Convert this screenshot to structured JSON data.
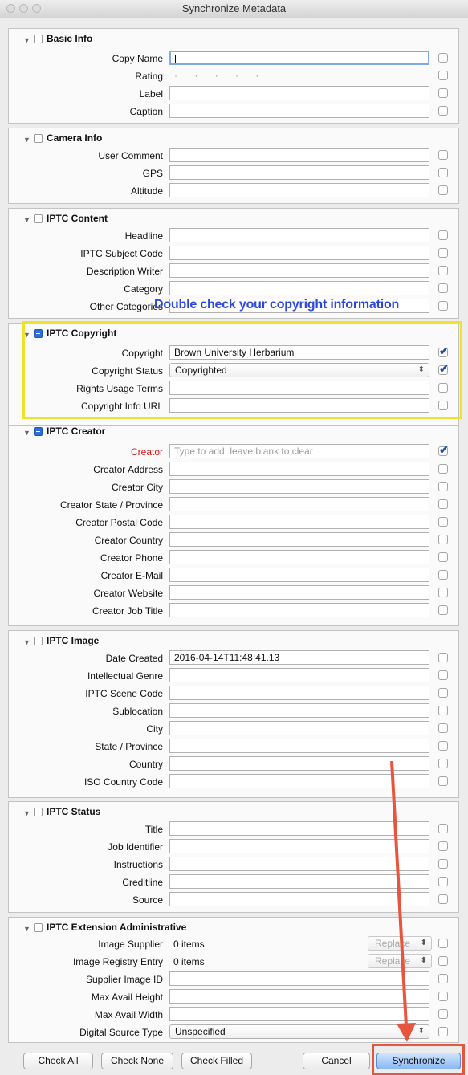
{
  "window": {
    "title": "Synchronize Metadata"
  },
  "sections": {
    "basic": {
      "title": "Basic Info",
      "copy_name": "Copy Name",
      "rating": "Rating",
      "rating_value": "· · · · ·",
      "label": "Label",
      "caption": "Caption"
    },
    "camera": {
      "title": "Camera Info",
      "user_comment": "User Comment",
      "gps": "GPS",
      "altitude": "Altitude"
    },
    "content": {
      "title": "IPTC Content",
      "headline": "Headline",
      "subject_code": "IPTC Subject Code",
      "description_writer": "Description Writer",
      "category": "Category",
      "other_categories": "Other Categories"
    },
    "copyright": {
      "title": "IPTC Copyright",
      "copyright": "Copyright",
      "copyright_value": "Brown University Herbarium",
      "status": "Copyright Status",
      "status_value": "Copyrighted",
      "usage_terms": "Rights Usage Terms",
      "info_url": "Copyright Info URL"
    },
    "creator": {
      "title": "IPTC Creator",
      "creator": "Creator",
      "creator_placeholder": "Type to add, leave blank to clear",
      "address": "Creator Address",
      "city": "Creator City",
      "state": "Creator State / Province",
      "postal": "Creator Postal Code",
      "country": "Creator Country",
      "phone": "Creator Phone",
      "email": "Creator E-Mail",
      "website": "Creator Website",
      "job_title": "Creator Job Title"
    },
    "image": {
      "title": "IPTC Image",
      "date_created": "Date Created",
      "date_value": "2016-04-14T11:48:41.13",
      "genre": "Intellectual Genre",
      "scene_code": "IPTC Scene Code",
      "sublocation": "Sublocation",
      "city": "City",
      "state": "State / Province",
      "country": "Country",
      "iso_code": "ISO Country Code"
    },
    "status": {
      "title": "IPTC Status",
      "title_field": "Title",
      "job_identifier": "Job Identifier",
      "instructions": "Instructions",
      "creditline": "Creditline",
      "source": "Source"
    },
    "extension": {
      "title": "IPTC Extension Administrative",
      "image_supplier": "Image Supplier",
      "image_supplier_value": "0 items",
      "registry_entry": "Image Registry Entry",
      "registry_value": "0 items",
      "replace_label": "Replace",
      "supplier_image_id": "Supplier Image ID",
      "max_height": "Max Avail Height",
      "max_width": "Max Avail Width",
      "digital_source": "Digital Source Type",
      "digital_source_value": "Unspecified"
    }
  },
  "annotation": "Double check your copyright information",
  "buttons": {
    "check_all": "Check All",
    "check_none": "Check None",
    "check_filled": "Check Filled",
    "cancel": "Cancel",
    "synchronize": "Synchronize"
  },
  "colors": {
    "annotation_text": "#2b47e0",
    "highlight_box": "#f0e12a",
    "arrow": "#e6553f",
    "required_label": "#d21a1a"
  }
}
